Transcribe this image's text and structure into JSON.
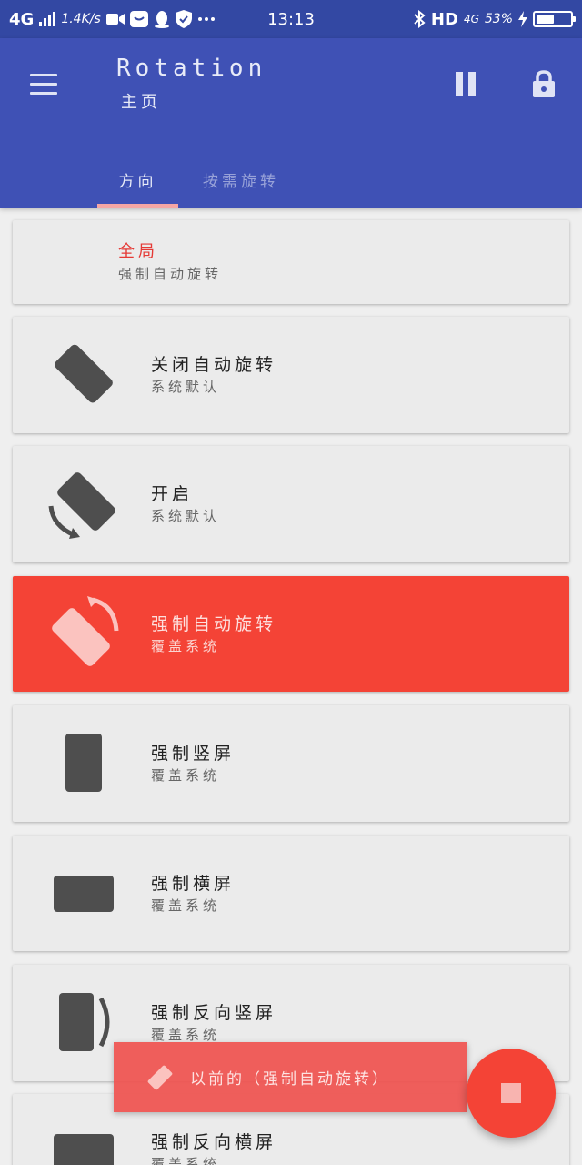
{
  "statusbar": {
    "network": "4G",
    "speed": "1.4K/s",
    "time": "13:13",
    "hd": "HD",
    "net2": "4G",
    "battery_text": "53%",
    "battery_level": 0.53
  },
  "appbar": {
    "title": "Rotation",
    "subtitle": "主页",
    "tabs": [
      {
        "label": "方向"
      },
      {
        "label": "按需旋转"
      }
    ]
  },
  "list": [
    {
      "title": "全局",
      "subtitle": "强制自动旋转",
      "icon": "none"
    },
    {
      "title": "关闭自动旋转",
      "subtitle": "系统默认",
      "icon": "rotation-lock-icon"
    },
    {
      "title": "开启",
      "subtitle": "系统默认",
      "icon": "rotation-auto-icon"
    },
    {
      "title": "强制自动旋转",
      "subtitle": "覆盖系统",
      "icon": "rotation-force-auto-icon"
    },
    {
      "title": "强制竖屏",
      "subtitle": "覆盖系统",
      "icon": "portrait-icon"
    },
    {
      "title": "强制横屏",
      "subtitle": "覆盖系统",
      "icon": "landscape-icon"
    },
    {
      "title": "强制反向竖屏",
      "subtitle": "覆盖系统",
      "icon": "reverse-portrait-icon"
    },
    {
      "title": "强制反向横屏",
      "subtitle": "覆盖系统",
      "icon": "reverse-landscape-icon"
    }
  ],
  "snackbar": {
    "text": "以前的（强制自动旋转）"
  },
  "colors": {
    "primary": "#3f51b5",
    "statusbar": "#3348a3",
    "accent": "#f44336",
    "card": "#ebebeb",
    "icon": "#4e4e4e"
  }
}
